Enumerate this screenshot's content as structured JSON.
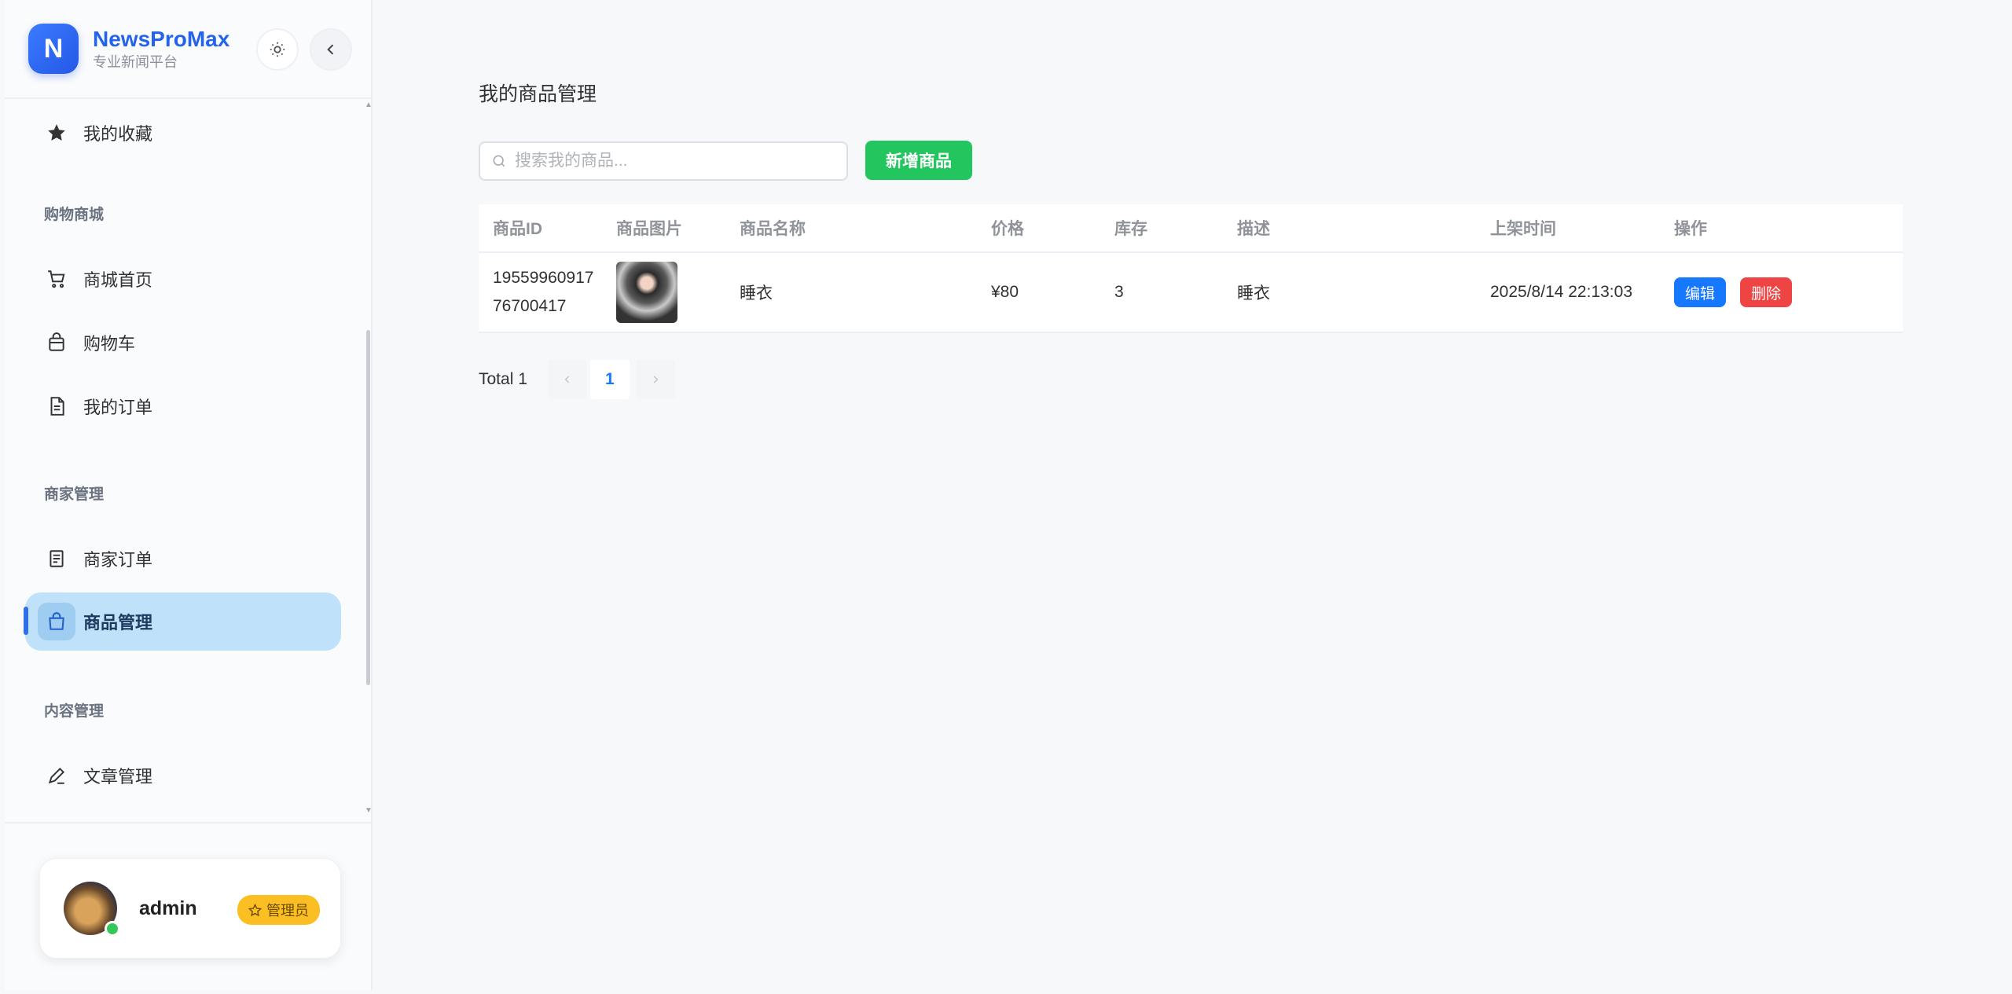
{
  "brand": {
    "logo_letter": "N",
    "name": "NewsProMax",
    "subtitle": "专业新闻平台"
  },
  "sidebar": {
    "items": [
      {
        "label": "我的收藏",
        "icon": "star-icon"
      },
      {
        "label": "商城首页",
        "icon": "cart-icon"
      },
      {
        "label": "购物车",
        "icon": "bag-icon"
      },
      {
        "label": "我的订单",
        "icon": "document-icon"
      },
      {
        "label": "商家订单",
        "icon": "list-document-icon"
      },
      {
        "label": "商品管理",
        "icon": "shopping-bag-icon",
        "active": true
      },
      {
        "label": "文章管理",
        "icon": "pen-icon"
      }
    ],
    "groups": {
      "shop": "购物商城",
      "merchant": "商家管理",
      "content": "内容管理"
    }
  },
  "user": {
    "name": "admin",
    "role": "管理员"
  },
  "main": {
    "title": "我的商品管理",
    "search_placeholder": "搜索我的商品...",
    "add_button": "新增商品",
    "table": {
      "headers": [
        "商品ID",
        "商品图片",
        "商品名称",
        "价格",
        "库存",
        "描述",
        "上架时间",
        "操作"
      ],
      "rows": [
        {
          "id": "1955996091776700417",
          "name": "睡衣",
          "price": "¥80",
          "stock": "3",
          "desc": "睡衣",
          "time": "2025/8/14 22:13:03"
        }
      ],
      "edit_label": "编辑",
      "delete_label": "删除"
    },
    "pagination": {
      "total_text": "Total 1",
      "current_page": "1"
    }
  },
  "colors": {
    "accent": "#2463eb",
    "success": "#22c55e",
    "danger": "#ef4444",
    "primary": "#1677ff",
    "active_bg": "#bfe1f9"
  }
}
